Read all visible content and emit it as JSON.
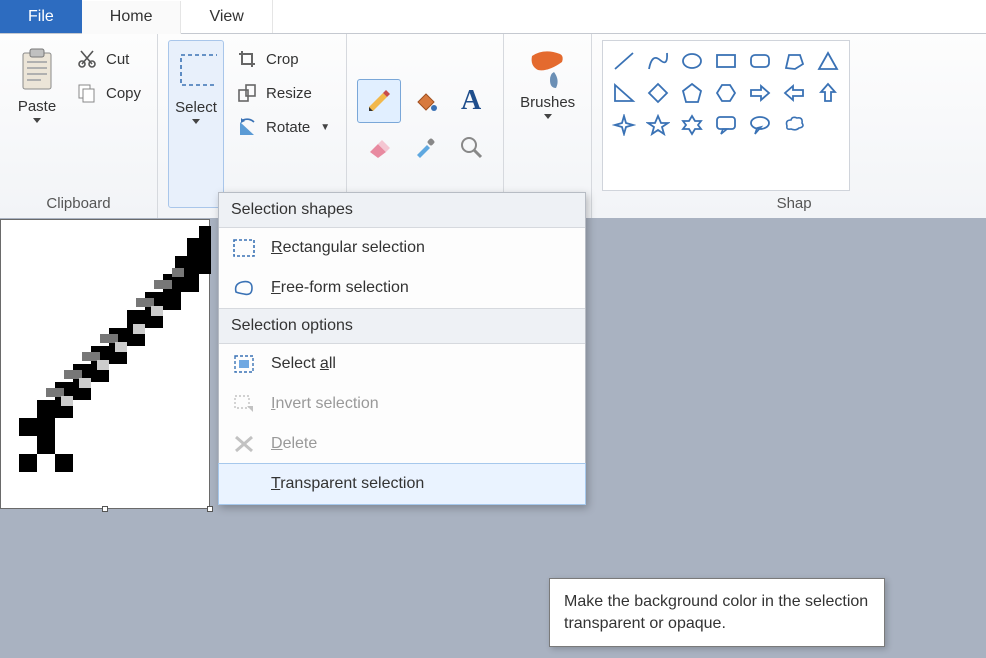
{
  "tabs": {
    "file": "File",
    "home": "Home",
    "view": "View"
  },
  "clipboard": {
    "paste": "Paste",
    "cut": "Cut",
    "copy": "Copy",
    "label": "Clipboard"
  },
  "image": {
    "select": "Select",
    "crop": "Crop",
    "resize": "Resize",
    "rotate": "Rotate"
  },
  "brushes": {
    "label": "Brushes"
  },
  "shapes_label": "Shap",
  "dropdown": {
    "section_shapes": "Selection shapes",
    "rect_prefix": "R",
    "rect_rest": "ectangular selection",
    "free_prefix": "F",
    "free_rest": "ree-form selection",
    "section_options": "Selection options",
    "all_before": "Select ",
    "all_u": "a",
    "all_after": "ll",
    "invert_prefix": "I",
    "invert_rest": "nvert selection",
    "delete_prefix": "D",
    "delete_rest": "elete",
    "trans_prefix": "T",
    "trans_rest": "ransparent selection"
  },
  "tooltip": "Make the background color in the selection transparent or opaque."
}
